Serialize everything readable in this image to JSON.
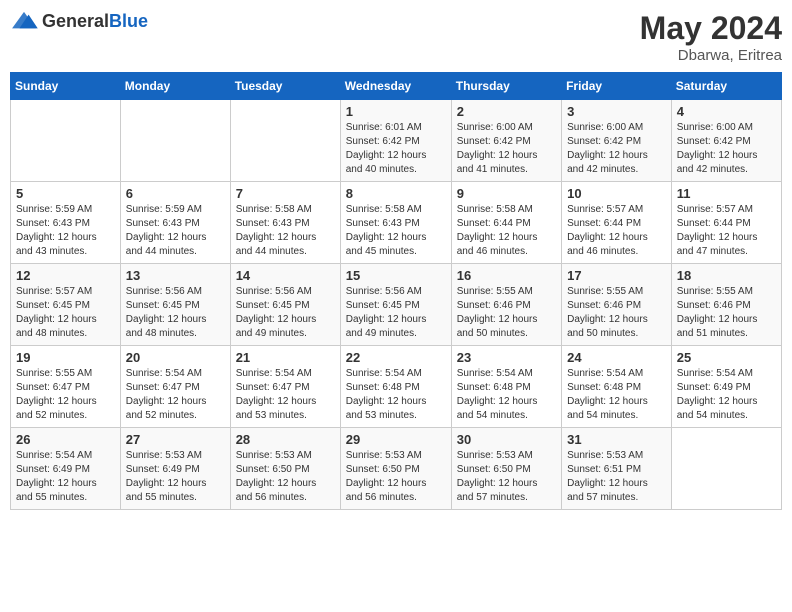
{
  "logo": {
    "general": "General",
    "blue": "Blue"
  },
  "title": {
    "month_year": "May 2024",
    "location": "Dbarwa, Eritrea"
  },
  "headers": [
    "Sunday",
    "Monday",
    "Tuesday",
    "Wednesday",
    "Thursday",
    "Friday",
    "Saturday"
  ],
  "weeks": [
    [
      {
        "day": "",
        "info": ""
      },
      {
        "day": "",
        "info": ""
      },
      {
        "day": "",
        "info": ""
      },
      {
        "day": "1",
        "info": "Sunrise: 6:01 AM\nSunset: 6:42 PM\nDaylight: 12 hours\nand 40 minutes."
      },
      {
        "day": "2",
        "info": "Sunrise: 6:00 AM\nSunset: 6:42 PM\nDaylight: 12 hours\nand 41 minutes."
      },
      {
        "day": "3",
        "info": "Sunrise: 6:00 AM\nSunset: 6:42 PM\nDaylight: 12 hours\nand 42 minutes."
      },
      {
        "day": "4",
        "info": "Sunrise: 6:00 AM\nSunset: 6:42 PM\nDaylight: 12 hours\nand 42 minutes."
      }
    ],
    [
      {
        "day": "5",
        "info": "Sunrise: 5:59 AM\nSunset: 6:43 PM\nDaylight: 12 hours\nand 43 minutes."
      },
      {
        "day": "6",
        "info": "Sunrise: 5:59 AM\nSunset: 6:43 PM\nDaylight: 12 hours\nand 44 minutes."
      },
      {
        "day": "7",
        "info": "Sunrise: 5:58 AM\nSunset: 6:43 PM\nDaylight: 12 hours\nand 44 minutes."
      },
      {
        "day": "8",
        "info": "Sunrise: 5:58 AM\nSunset: 6:43 PM\nDaylight: 12 hours\nand 45 minutes."
      },
      {
        "day": "9",
        "info": "Sunrise: 5:58 AM\nSunset: 6:44 PM\nDaylight: 12 hours\nand 46 minutes."
      },
      {
        "day": "10",
        "info": "Sunrise: 5:57 AM\nSunset: 6:44 PM\nDaylight: 12 hours\nand 46 minutes."
      },
      {
        "day": "11",
        "info": "Sunrise: 5:57 AM\nSunset: 6:44 PM\nDaylight: 12 hours\nand 47 minutes."
      }
    ],
    [
      {
        "day": "12",
        "info": "Sunrise: 5:57 AM\nSunset: 6:45 PM\nDaylight: 12 hours\nand 48 minutes."
      },
      {
        "day": "13",
        "info": "Sunrise: 5:56 AM\nSunset: 6:45 PM\nDaylight: 12 hours\nand 48 minutes."
      },
      {
        "day": "14",
        "info": "Sunrise: 5:56 AM\nSunset: 6:45 PM\nDaylight: 12 hours\nand 49 minutes."
      },
      {
        "day": "15",
        "info": "Sunrise: 5:56 AM\nSunset: 6:45 PM\nDaylight: 12 hours\nand 49 minutes."
      },
      {
        "day": "16",
        "info": "Sunrise: 5:55 AM\nSunset: 6:46 PM\nDaylight: 12 hours\nand 50 minutes."
      },
      {
        "day": "17",
        "info": "Sunrise: 5:55 AM\nSunset: 6:46 PM\nDaylight: 12 hours\nand 50 minutes."
      },
      {
        "day": "18",
        "info": "Sunrise: 5:55 AM\nSunset: 6:46 PM\nDaylight: 12 hours\nand 51 minutes."
      }
    ],
    [
      {
        "day": "19",
        "info": "Sunrise: 5:55 AM\nSunset: 6:47 PM\nDaylight: 12 hours\nand 52 minutes."
      },
      {
        "day": "20",
        "info": "Sunrise: 5:54 AM\nSunset: 6:47 PM\nDaylight: 12 hours\nand 52 minutes."
      },
      {
        "day": "21",
        "info": "Sunrise: 5:54 AM\nSunset: 6:47 PM\nDaylight: 12 hours\nand 53 minutes."
      },
      {
        "day": "22",
        "info": "Sunrise: 5:54 AM\nSunset: 6:48 PM\nDaylight: 12 hours\nand 53 minutes."
      },
      {
        "day": "23",
        "info": "Sunrise: 5:54 AM\nSunset: 6:48 PM\nDaylight: 12 hours\nand 54 minutes."
      },
      {
        "day": "24",
        "info": "Sunrise: 5:54 AM\nSunset: 6:48 PM\nDaylight: 12 hours\nand 54 minutes."
      },
      {
        "day": "25",
        "info": "Sunrise: 5:54 AM\nSunset: 6:49 PM\nDaylight: 12 hours\nand 54 minutes."
      }
    ],
    [
      {
        "day": "26",
        "info": "Sunrise: 5:54 AM\nSunset: 6:49 PM\nDaylight: 12 hours\nand 55 minutes."
      },
      {
        "day": "27",
        "info": "Sunrise: 5:53 AM\nSunset: 6:49 PM\nDaylight: 12 hours\nand 55 minutes."
      },
      {
        "day": "28",
        "info": "Sunrise: 5:53 AM\nSunset: 6:50 PM\nDaylight: 12 hours\nand 56 minutes."
      },
      {
        "day": "29",
        "info": "Sunrise: 5:53 AM\nSunset: 6:50 PM\nDaylight: 12 hours\nand 56 minutes."
      },
      {
        "day": "30",
        "info": "Sunrise: 5:53 AM\nSunset: 6:50 PM\nDaylight: 12 hours\nand 57 minutes."
      },
      {
        "day": "31",
        "info": "Sunrise: 5:53 AM\nSunset: 6:51 PM\nDaylight: 12 hours\nand 57 minutes."
      },
      {
        "day": "",
        "info": ""
      }
    ]
  ]
}
